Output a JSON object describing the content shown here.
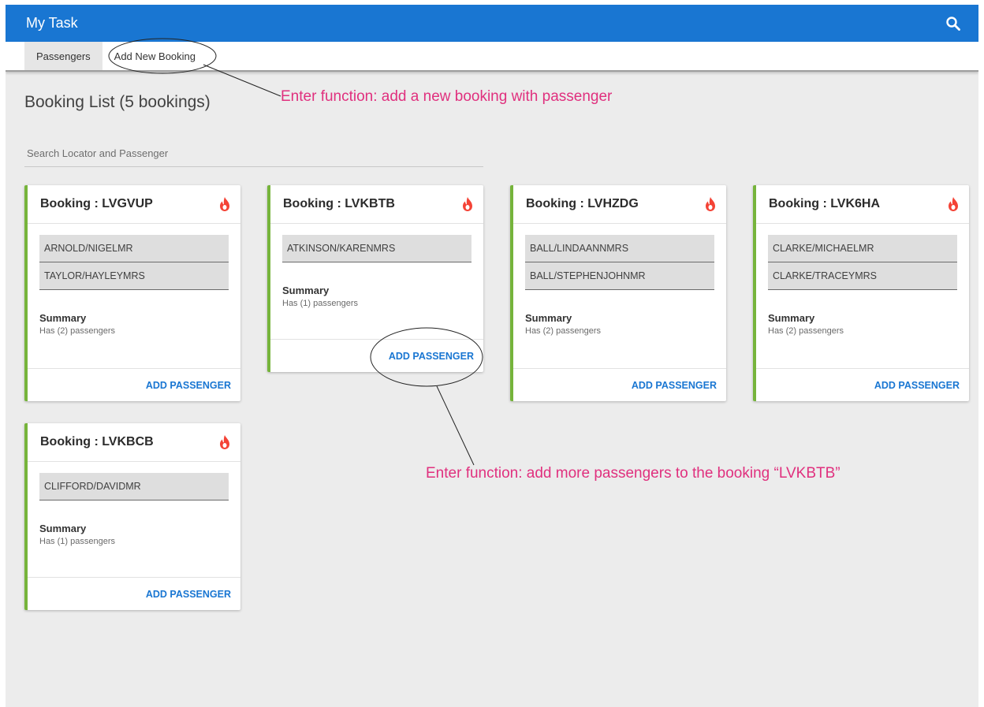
{
  "app": {
    "title": "My Task",
    "search_icon": "search-icon"
  },
  "nav": {
    "tabs": [
      {
        "label": "Passengers"
      },
      {
        "label": "Add New Booking"
      }
    ]
  },
  "heading": "Booking List (5 bookings)",
  "search": {
    "placeholder": "Search Locator and Passenger",
    "value": ""
  },
  "labels": {
    "summary": "Summary",
    "add_passenger": "ADD PASSENGER"
  },
  "colors": {
    "app_bar": "#1976d2",
    "card_accent": "#76b43b",
    "fire_icon": "#f44336",
    "annotation": "#e0307e"
  },
  "bookings": [
    {
      "title": "Booking : LVGVUP",
      "passengers": [
        "ARNOLD/NIGELMR",
        "TAYLOR/HAYLEYMRS"
      ],
      "summary": "Has (2) passengers"
    },
    {
      "title": "Booking : LVKBTB",
      "passengers": [
        "ATKINSON/KARENMRS"
      ],
      "summary": "Has (1) passengers"
    },
    {
      "title": "Booking : LVHZDG",
      "passengers": [
        "BALL/LINDAANNMRS",
        "BALL/STEPHENJOHNMR"
      ],
      "summary": "Has (2) passengers"
    },
    {
      "title": "Booking : LVK6HA",
      "passengers": [
        "CLARKE/MICHAELMR",
        "CLARKE/TRACEYMRS"
      ],
      "summary": "Has (2) passengers"
    },
    {
      "title": "Booking : LVKBCB",
      "passengers": [
        "CLIFFORD/DAVIDMR"
      ],
      "summary": "Has (1) passengers"
    }
  ],
  "annotations": [
    {
      "text": "Enter function: add a new booking with passenger"
    },
    {
      "text": "Enter function: add more passengers to the booking “LVKBTB”"
    }
  ]
}
